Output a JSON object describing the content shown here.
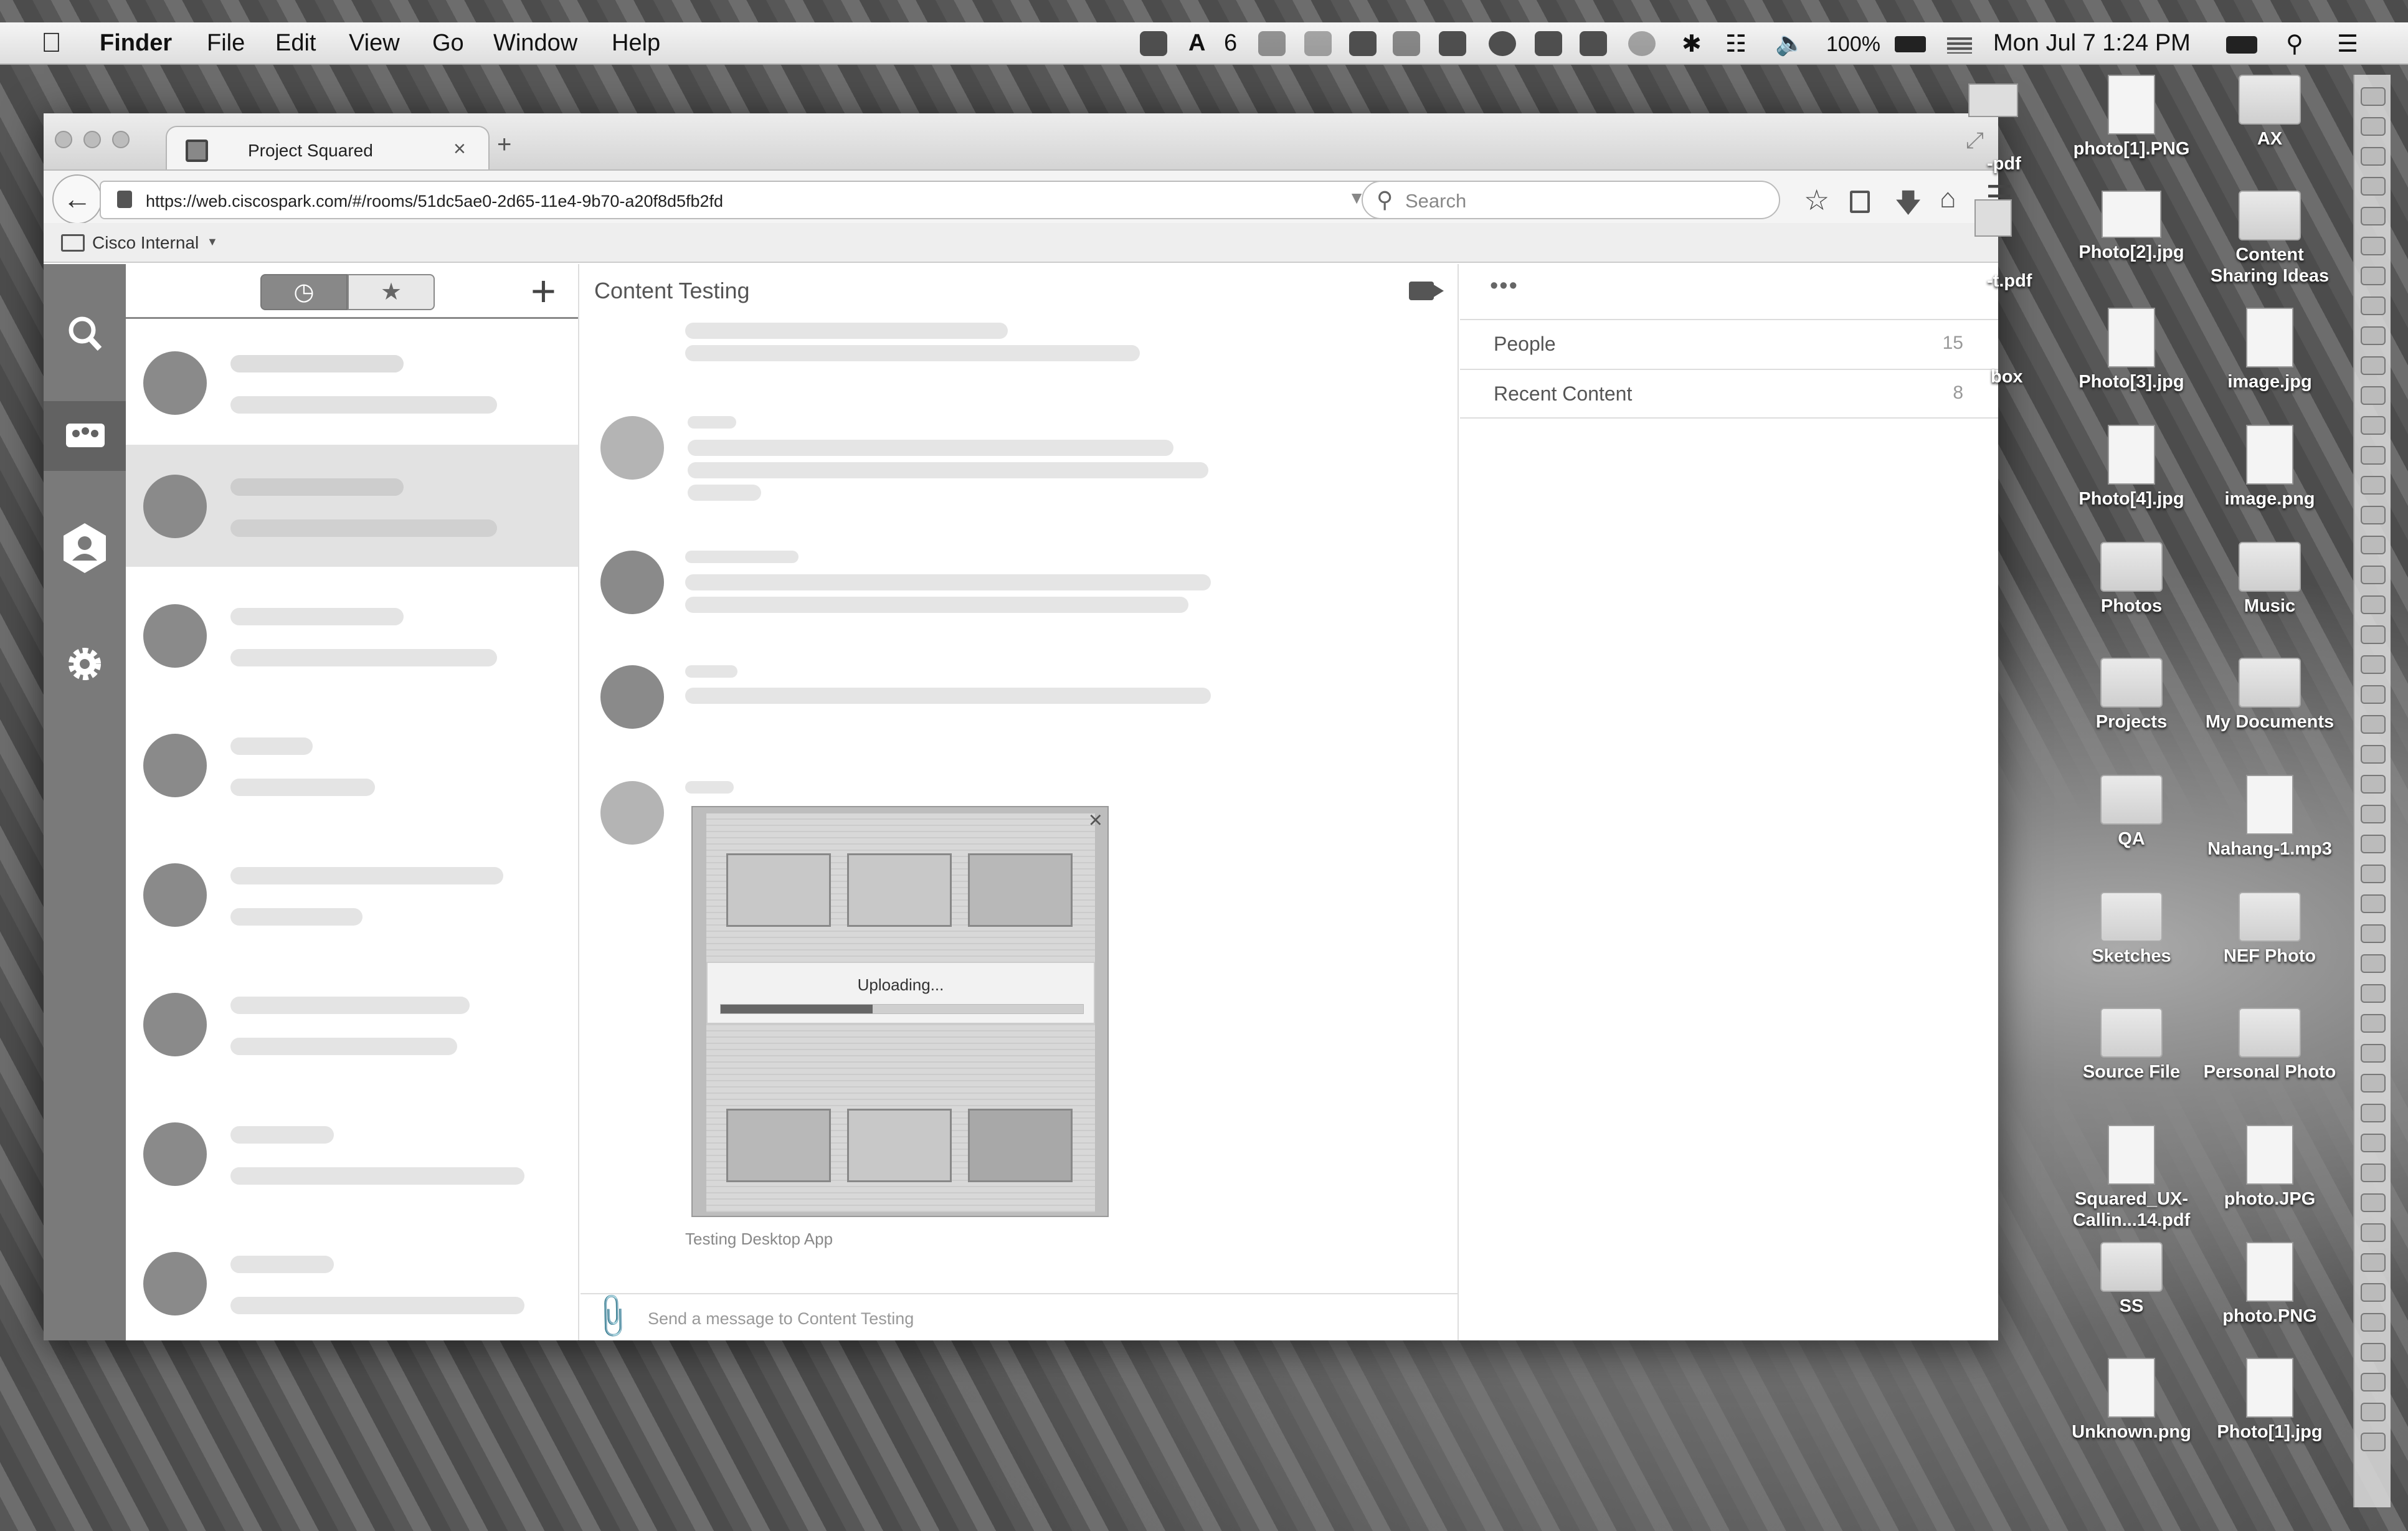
{
  "menubar": {
    "app_name": "Finder",
    "menus": [
      "File",
      "Edit",
      "View",
      "Go",
      "Window",
      "Help"
    ],
    "adobe_badge": "6",
    "battery": "100%",
    "datetime": "Mon Jul 7  1:24 PM"
  },
  "browser": {
    "tab_title": "Project Squared",
    "tab_close": "×",
    "new_tab": "+",
    "url": "https://web.ciscospark.com/#/rooms/51dc5ae0-2d65-11e4-9b70-a20f8d5fb2fd",
    "search_placeholder": "Search",
    "bookmark_folder": "Cisco Internal"
  },
  "app": {
    "room_title": "Content Testing",
    "upload_status": "Uploading...",
    "upload_progress": 0.42,
    "upload_close": "×",
    "file_caption": "Testing Desktop App",
    "composer_placeholder": "Send a message to Content Testing",
    "more": "•••",
    "sidebar": [
      {
        "label": "People",
        "count": "15"
      },
      {
        "label": "Recent Content",
        "count": "8"
      }
    ]
  },
  "desktop": {
    "partial_left": [
      "-pdf",
      "-t.pdf",
      "box"
    ],
    "items_col1": [
      "photo[1].PNG",
      "Photo[2].jpg",
      "Photo[3].jpg",
      "Photo[4].jpg",
      "Photos",
      "Projects",
      "QA",
      "Sketches",
      "Source File",
      "Squared_UX-Callin...14.pdf",
      "SS",
      "Unknown.png"
    ],
    "items_col2": [
      "AX",
      "Content Sharing Ideas",
      "image.jpg",
      "image.png",
      "Music",
      "My Documents",
      "Nahang-1.mp3",
      "NEF Photo",
      "Personal Photo",
      "photo.JPG",
      "photo.PNG",
      "Photo[1].jpg"
    ]
  }
}
